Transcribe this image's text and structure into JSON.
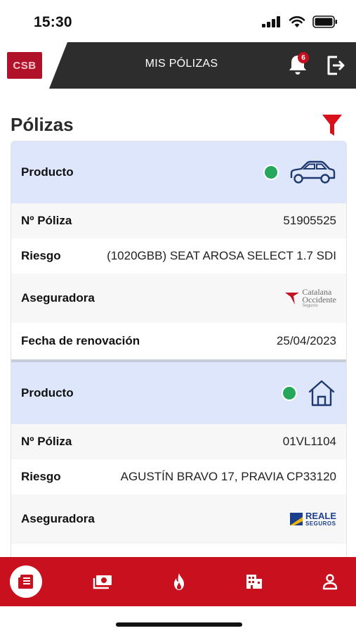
{
  "status_bar": {
    "time": "15:30"
  },
  "header": {
    "logo_text": "CSB",
    "title": "MIS PÓLIZAS",
    "notification_count": "6"
  },
  "page": {
    "title": "Pólizas"
  },
  "policies": [
    {
      "product_label": "Producto",
      "product_icon": "car-icon",
      "status_color": "#25a85b",
      "policy_label": "Nº Póliza",
      "policy_number": "51905525",
      "risk_label": "Riesgo",
      "risk": "(1020GBB) SEAT AROSA SELECT 1.7 SDI",
      "insurer_label": "Aseguradora",
      "insurer_logo": {
        "line1": "Catalana",
        "line2": "Occidente",
        "line3": "Seguros"
      },
      "renewal_label": "Fecha de renovación",
      "renewal_date": "25/04/2023"
    },
    {
      "product_label": "Producto",
      "product_icon": "house-icon",
      "status_color": "#25a85b",
      "policy_label": "Nº Póliza",
      "policy_number": "01VL1104",
      "risk_label": "Riesgo",
      "risk": "AGUSTÍN BRAVO 17, PRAVIA CP33120",
      "insurer_label": "Aseguradora",
      "insurer_logo": {
        "line1": "REALE",
        "line2": "SEGUROS"
      }
    }
  ],
  "bottom_nav": [
    {
      "icon": "policies-icon",
      "active": true
    },
    {
      "icon": "money-icon",
      "active": false
    },
    {
      "icon": "fire-icon",
      "active": false
    },
    {
      "icon": "building-icon",
      "active": false
    },
    {
      "icon": "user-icon",
      "active": false
    }
  ],
  "colors": {
    "brand_red": "#c8101e",
    "header_dark": "#2d2d2d",
    "product_row_bg": "#dde6fb",
    "icon_blue": "#1f3a6e"
  }
}
